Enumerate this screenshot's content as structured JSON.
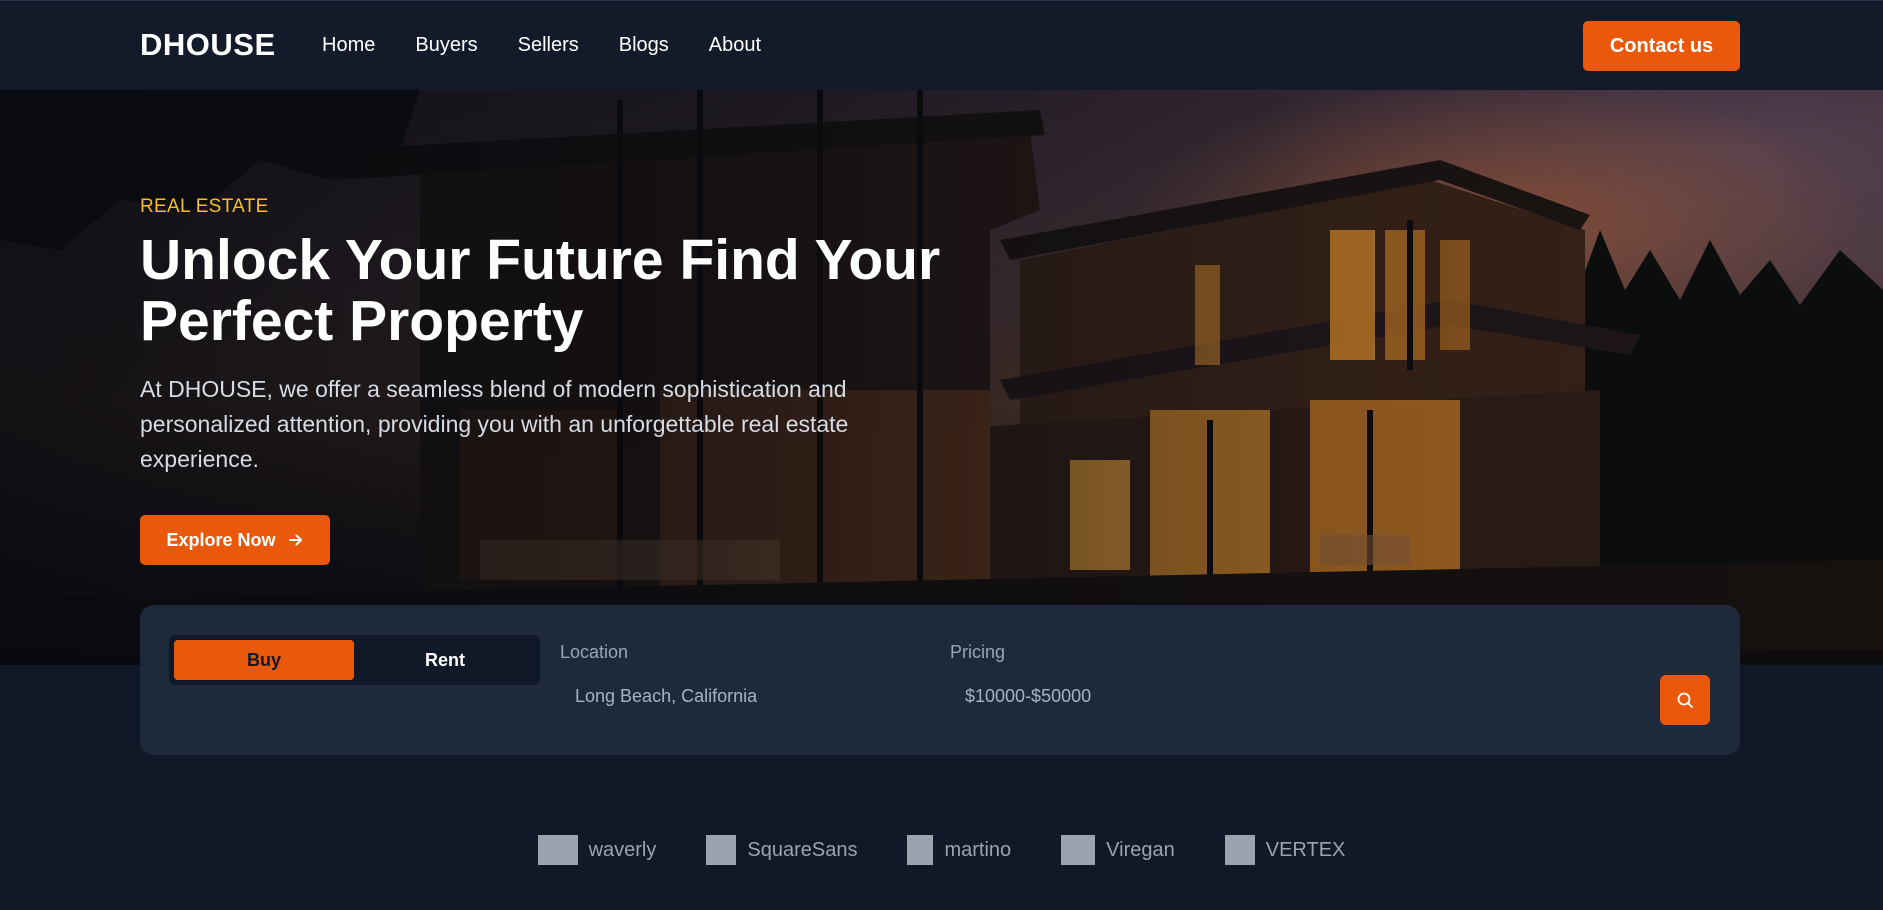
{
  "brand": "DHOUSE",
  "nav": {
    "links": [
      {
        "label": "Home"
      },
      {
        "label": "Buyers"
      },
      {
        "label": "Sellers"
      },
      {
        "label": "Blogs"
      },
      {
        "label": "About"
      }
    ],
    "contact_label": "Contact us"
  },
  "hero": {
    "eyebrow": "REAL ESTATE",
    "title_line1": "Unlock Your Future Find Your",
    "title_line2": "Perfect Property",
    "description": "At DHOUSE, we offer a seamless blend of modern sophistication and personalized attention, providing you with an unforgettable real estate experience.",
    "cta_label": "Explore Now",
    "cta_icon": "arrow-right-icon"
  },
  "search": {
    "tabs": [
      {
        "label": "Buy",
        "active": true
      },
      {
        "label": "Rent",
        "active": false
      }
    ],
    "location_label": "Location",
    "location_value": "Long Beach, California",
    "pricing_label": "Pricing",
    "pricing_value": "$10000-$50000",
    "search_icon": "search-icon"
  },
  "logos": [
    {
      "name": "waverly"
    },
    {
      "name": "SquareSans"
    },
    {
      "name": "martino"
    },
    {
      "name": "Viregan"
    },
    {
      "name": "VERTEX"
    }
  ],
  "colors": {
    "accent": "#ea580c",
    "eyebrow": "#fbbf24",
    "page_bg": "#111827",
    "nav_bg": "#131b2b",
    "card_bg": "#1e293b"
  }
}
